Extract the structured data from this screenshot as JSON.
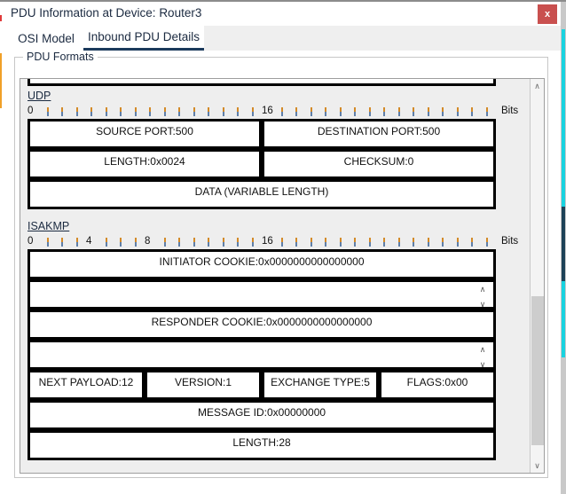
{
  "window": {
    "title": "PDU Information at Device: Router3",
    "close_label": "x"
  },
  "tabs": [
    {
      "label": "OSI Model",
      "active": false
    },
    {
      "label": "Inbound PDU Details",
      "active": true
    }
  ],
  "groupbox": {
    "label": "PDU Formats"
  },
  "scrollbar": {
    "up_arrow": "∧",
    "down_arrow": "∨"
  },
  "spinner": {
    "up": "∧",
    "down": "∨"
  },
  "protocols": [
    {
      "name": "UDP",
      "ruler": {
        "labels": [
          {
            "text": "0",
            "bit": 0
          },
          {
            "text": "16",
            "bit": 16
          }
        ],
        "bits_label": "Bits",
        "tick_count": 32
      },
      "rows": [
        [
          {
            "text": "SOURCE PORT:500",
            "span": 16
          },
          {
            "text": "DESTINATION PORT:500",
            "span": 16
          }
        ],
        [
          {
            "text": "LENGTH:0x0024",
            "span": 16
          },
          {
            "text": "CHECKSUM:0",
            "span": 16
          }
        ],
        [
          {
            "text": "DATA (VARIABLE LENGTH)",
            "span": 32
          }
        ]
      ]
    },
    {
      "name": "ISAKMP",
      "ruler": {
        "labels": [
          {
            "text": "0",
            "bit": 0
          },
          {
            "text": "4",
            "bit": 4
          },
          {
            "text": "8",
            "bit": 8
          },
          {
            "text": "16",
            "bit": 16
          }
        ],
        "bits_label": "Bits",
        "tick_count": 32
      },
      "rows": [
        [
          {
            "text": "INITIATOR COOKIE:0x0000000000000000",
            "span": 32
          }
        ],
        [
          {
            "text": "",
            "span": 32,
            "spinner": true
          }
        ],
        [
          {
            "text": "RESPONDER COOKIE:0x0000000000000000",
            "span": 32
          }
        ],
        [
          {
            "text": "",
            "span": 32,
            "spinner": true
          }
        ],
        [
          {
            "text": "NEXT PAYLOAD:12",
            "span": 8
          },
          {
            "text": "VERSION:1",
            "span": 8
          },
          {
            "text": "EXCHANGE TYPE:5",
            "span": 8
          },
          {
            "text": "FLAGS:0x00",
            "span": 8
          }
        ],
        [
          {
            "text": "MESSAGE ID:0x00000000",
            "span": 32
          }
        ],
        [
          {
            "text": "LENGTH:28",
            "span": 32
          }
        ]
      ]
    }
  ],
  "colors": {
    "close_button": "#c9504f",
    "active_tab_underline": "#1b3a5c",
    "box_border": "#000000",
    "tick_top": "#d38a28",
    "tick_bottom": "#5f7fa8"
  }
}
